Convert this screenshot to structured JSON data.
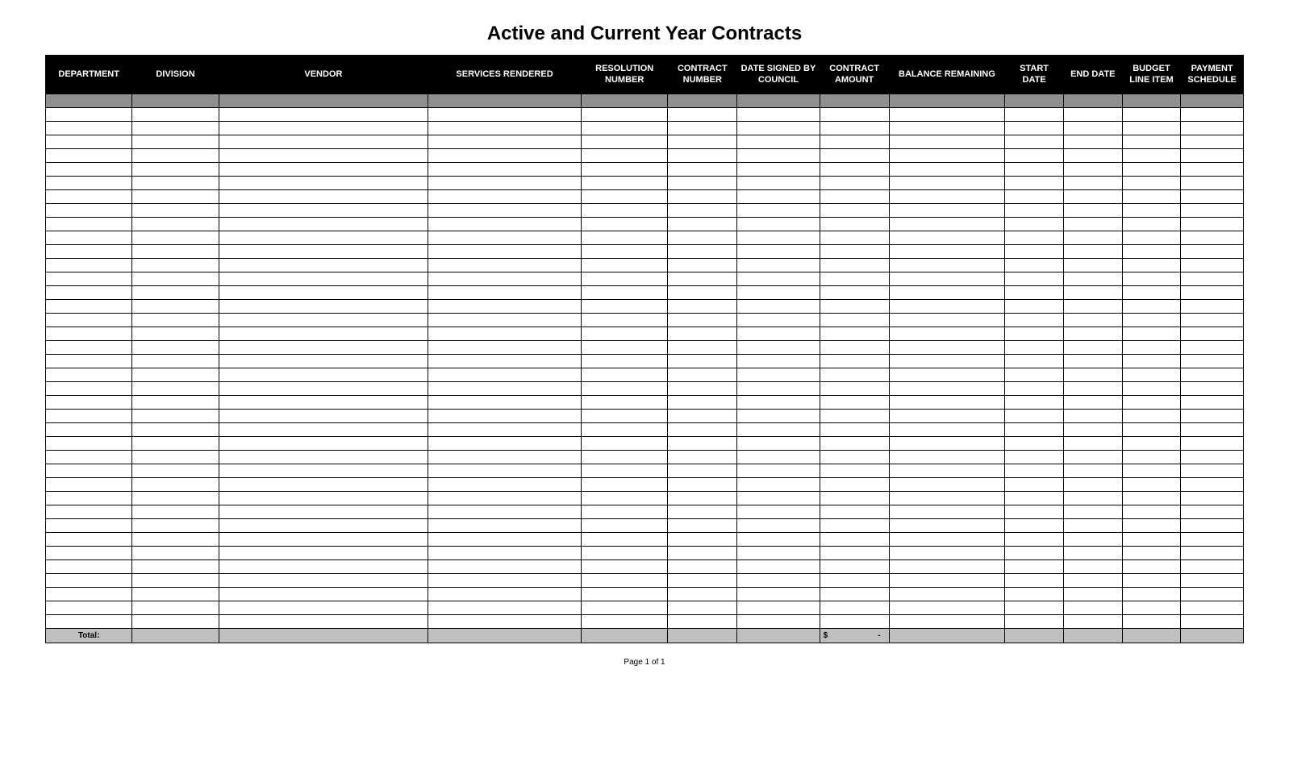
{
  "title": "Active and Current Year Contracts",
  "columns": [
    "DEPARTMENT",
    "DIVISION",
    "VENDOR",
    "SERVICES RENDERED",
    "RESOLUTION NUMBER",
    "CONTRACT NUMBER",
    "DATE SIGNED BY COUNCIL",
    "CONTRACT AMOUNT",
    "BALANCE REMAINING",
    "START DATE",
    "END DATE",
    "BUDGET LINE ITEM",
    "PAYMENT SCHEDULE"
  ],
  "blank_row_count": 38,
  "total": {
    "label": "Total:",
    "contract_amount": "$          -"
  },
  "footer": "Page 1 of 1"
}
